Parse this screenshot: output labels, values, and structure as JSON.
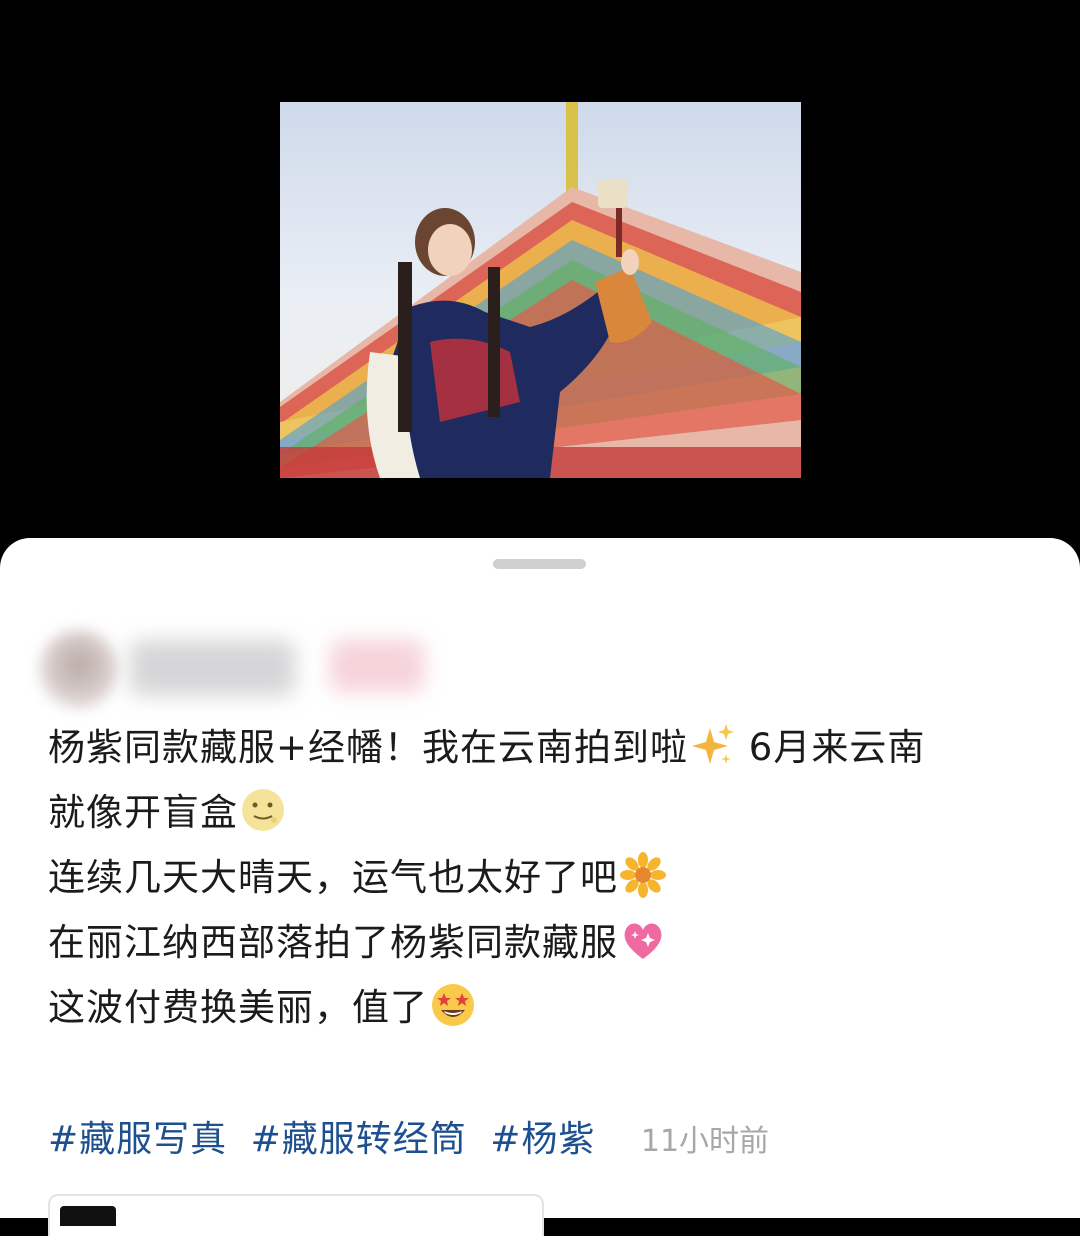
{
  "post": {
    "lines": [
      {
        "text": "杨紫同款藏服+经幡！我在云南拍到啦",
        "emoji": "sparkles-emoji",
        "after": " 6月来云南"
      },
      {
        "text": "就像开盲盒",
        "emoji": "moon-face-emoji"
      },
      {
        "text": "连续几天大晴天，运气也太好了吧",
        "emoji": "blossom-emoji"
      },
      {
        "text": "在丽江纳西部落拍了杨紫同款藏服",
        "emoji": "sparkling-heart-emoji"
      },
      {
        "text": "这波付费换美丽，值了",
        "emoji": "star-struck-emoji"
      }
    ],
    "tags": [
      "#藏服写真",
      "#藏服转经筒",
      "#杨紫"
    ],
    "time": "11小时前"
  },
  "colors": {
    "tag": "#1e4f8f",
    "time": "#a7a7a7",
    "text": "#1b1b1b",
    "background_top": "#000000",
    "sheet": "#ffffff"
  }
}
